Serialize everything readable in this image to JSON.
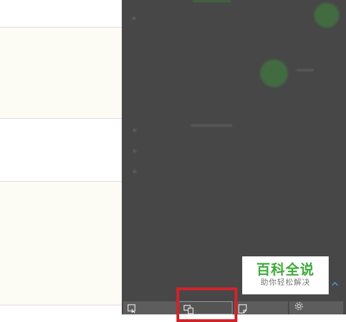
{
  "document": {
    "rows": [
      {
        "style": "white"
      },
      {
        "style": "cream"
      },
      {
        "style": "white"
      },
      {
        "style": "cream"
      },
      {
        "style": "white"
      }
    ]
  },
  "action_center": {
    "background_color": "#474747",
    "quick_actions": [
      {
        "icon": "tablet-mode-icon",
        "selected": false
      },
      {
        "icon": "project-icon",
        "selected": true
      },
      {
        "icon": "note-icon",
        "selected": false
      },
      {
        "icon": "settings-gear-icon",
        "selected": false
      }
    ],
    "collapse_icon": "chevron-up-icon"
  },
  "watermark": {
    "title": "百科全说",
    "subtitle": "助你轻松解决",
    "title_color": "#3cab37"
  },
  "annotation": {
    "highlight_color": "#d3222a"
  }
}
